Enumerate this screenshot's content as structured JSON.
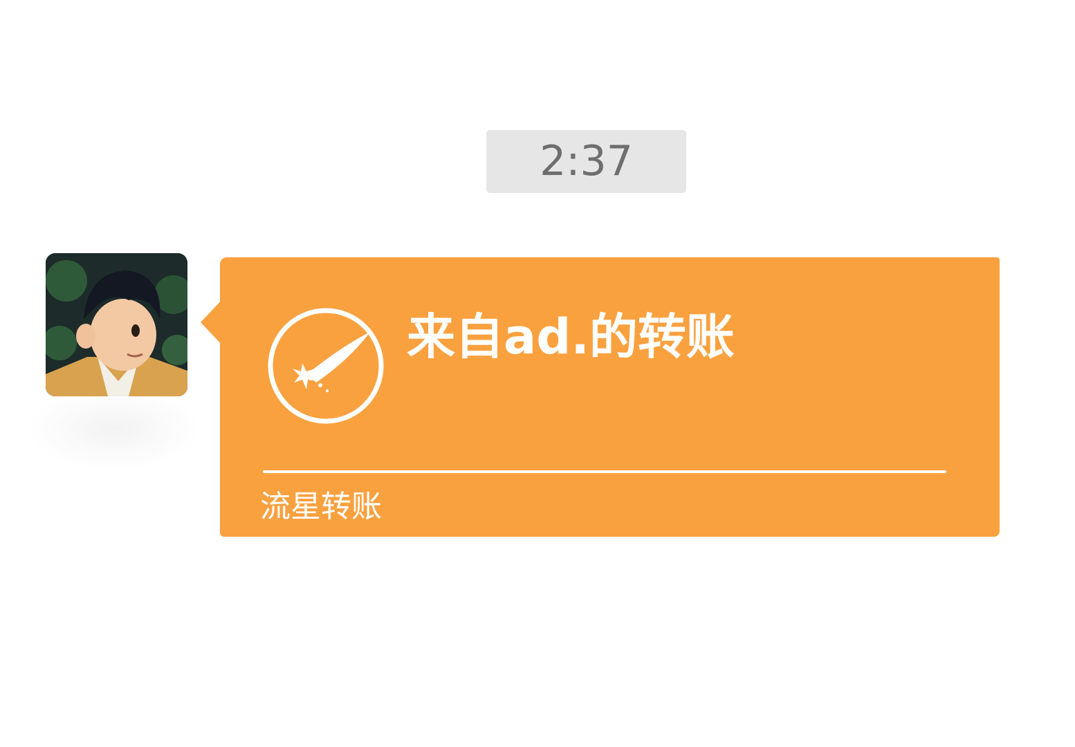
{
  "timestamp": {
    "text": "2:37"
  },
  "message": {
    "avatar_icon": "avatar-image",
    "bubble_color": "#f9a13f",
    "transfer": {
      "icon": "shooting-star-icon",
      "title": "来自ad.的转账",
      "type_label": "流星转账"
    }
  }
}
